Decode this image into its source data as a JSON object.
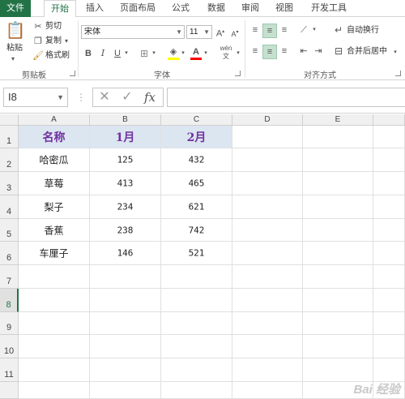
{
  "tabs": [
    {
      "label": "文件"
    },
    {
      "label": "开始"
    },
    {
      "label": "插入"
    },
    {
      "label": "页面布局"
    },
    {
      "label": "公式"
    },
    {
      "label": "数据"
    },
    {
      "label": "审阅"
    },
    {
      "label": "视图"
    },
    {
      "label": "开发工具"
    }
  ],
  "ribbon": {
    "clipboard": {
      "paste": "粘贴",
      "cut": "剪切",
      "copy": "复制",
      "format_painter": "格式刷",
      "group": "剪贴板"
    },
    "font": {
      "name": "宋体",
      "size": "11",
      "bold": "B",
      "italic": "I",
      "underline": "U",
      "wen": "wén",
      "group": "字体"
    },
    "alignment": {
      "wrap": "自动换行",
      "merge": "合并后居中",
      "group": "对齐方式"
    }
  },
  "formula_bar": {
    "name_box": "I8",
    "fx": "fx",
    "value": ""
  },
  "columns": [
    "A",
    "B",
    "C",
    "D",
    "E"
  ],
  "rows": [
    "1",
    "2",
    "3",
    "4",
    "5",
    "6",
    "7",
    "8",
    "9",
    "10",
    "11"
  ],
  "table": {
    "headers": [
      "名称",
      "1月",
      "2月"
    ],
    "rows": [
      [
        "哈密瓜",
        "125",
        "432"
      ],
      [
        "草莓",
        "413",
        "465"
      ],
      [
        "梨子",
        "234",
        "621"
      ],
      [
        "香蕉",
        "238",
        "742"
      ],
      [
        "车厘子",
        "146",
        "521"
      ]
    ]
  },
  "watermark": "Bai 经验",
  "colors": {
    "accent": "#217346",
    "header_fill": "#dce6f1",
    "header_text": "#7030a0"
  }
}
